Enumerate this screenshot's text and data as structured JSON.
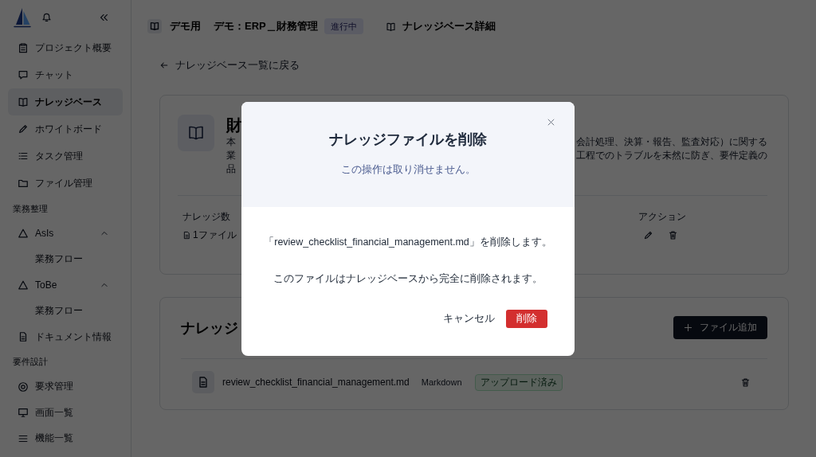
{
  "sidebar": {
    "sections": [
      {
        "items": [
          {
            "label": "プロジェクト概要",
            "selected": false
          },
          {
            "label": "チャット",
            "selected": false
          },
          {
            "label": "ナレッジベース",
            "selected": true
          },
          {
            "label": "ホワイトボード",
            "selected": false
          },
          {
            "label": "タスク管理",
            "selected": false
          },
          {
            "label": "ファイル管理",
            "selected": false
          }
        ]
      },
      {
        "heading": "業務整理",
        "items": [
          {
            "label": "AsIs",
            "selected": false,
            "expanded": true,
            "children": [
              {
                "label": "業務フロー",
                "selected": false
              }
            ]
          },
          {
            "label": "ToBe",
            "selected": false,
            "expanded": true,
            "children": [
              {
                "label": "業務フロー",
                "selected": false
              }
            ]
          },
          {
            "label": "ドキュメント情報",
            "selected": false
          }
        ]
      },
      {
        "heading": "要件設計",
        "items": [
          {
            "label": "要求管理",
            "selected": false
          },
          {
            "label": "画面一覧",
            "selected": false
          },
          {
            "label": "機能一覧",
            "selected": false
          }
        ]
      }
    ]
  },
  "breadcrumb": {
    "workspace": "デモ用",
    "project": "デモ：ERP＿財務管理",
    "status": "進行中",
    "page": "ナレッジベース詳細"
  },
  "back_link": "ナレッジベース一覧に戻る",
  "knowledge_base": {
    "title": "財",
    "description_lines": [
      {
        "start": "本",
        "end": "会計処理、決算・報告、監査対応）に関する"
      },
      {
        "start": "業",
        "end": "工程でのトラブルを未然に防ぎ、要件定義の"
      },
      {
        "start": "品"
      }
    ],
    "stat_label": "ナレッジ数",
    "stat_value": "1ファイル",
    "actions_label": "アクション"
  },
  "files": {
    "title": "ナレッジ",
    "add_button": "ファイル追加",
    "items": [
      {
        "name": "review_checklist_financial_management.md",
        "type": "Markdown",
        "status": "アップロード済み"
      }
    ]
  },
  "dialog": {
    "title": "ナレッジファイルを削除",
    "subtitle": "この操作は取り消せません。",
    "message": "「review_checklist_financial_management.md」を削除します。",
    "note": "このファイルはナレッジベースから完全に削除されます。",
    "cancel": "キャンセル",
    "confirm": "削除"
  }
}
